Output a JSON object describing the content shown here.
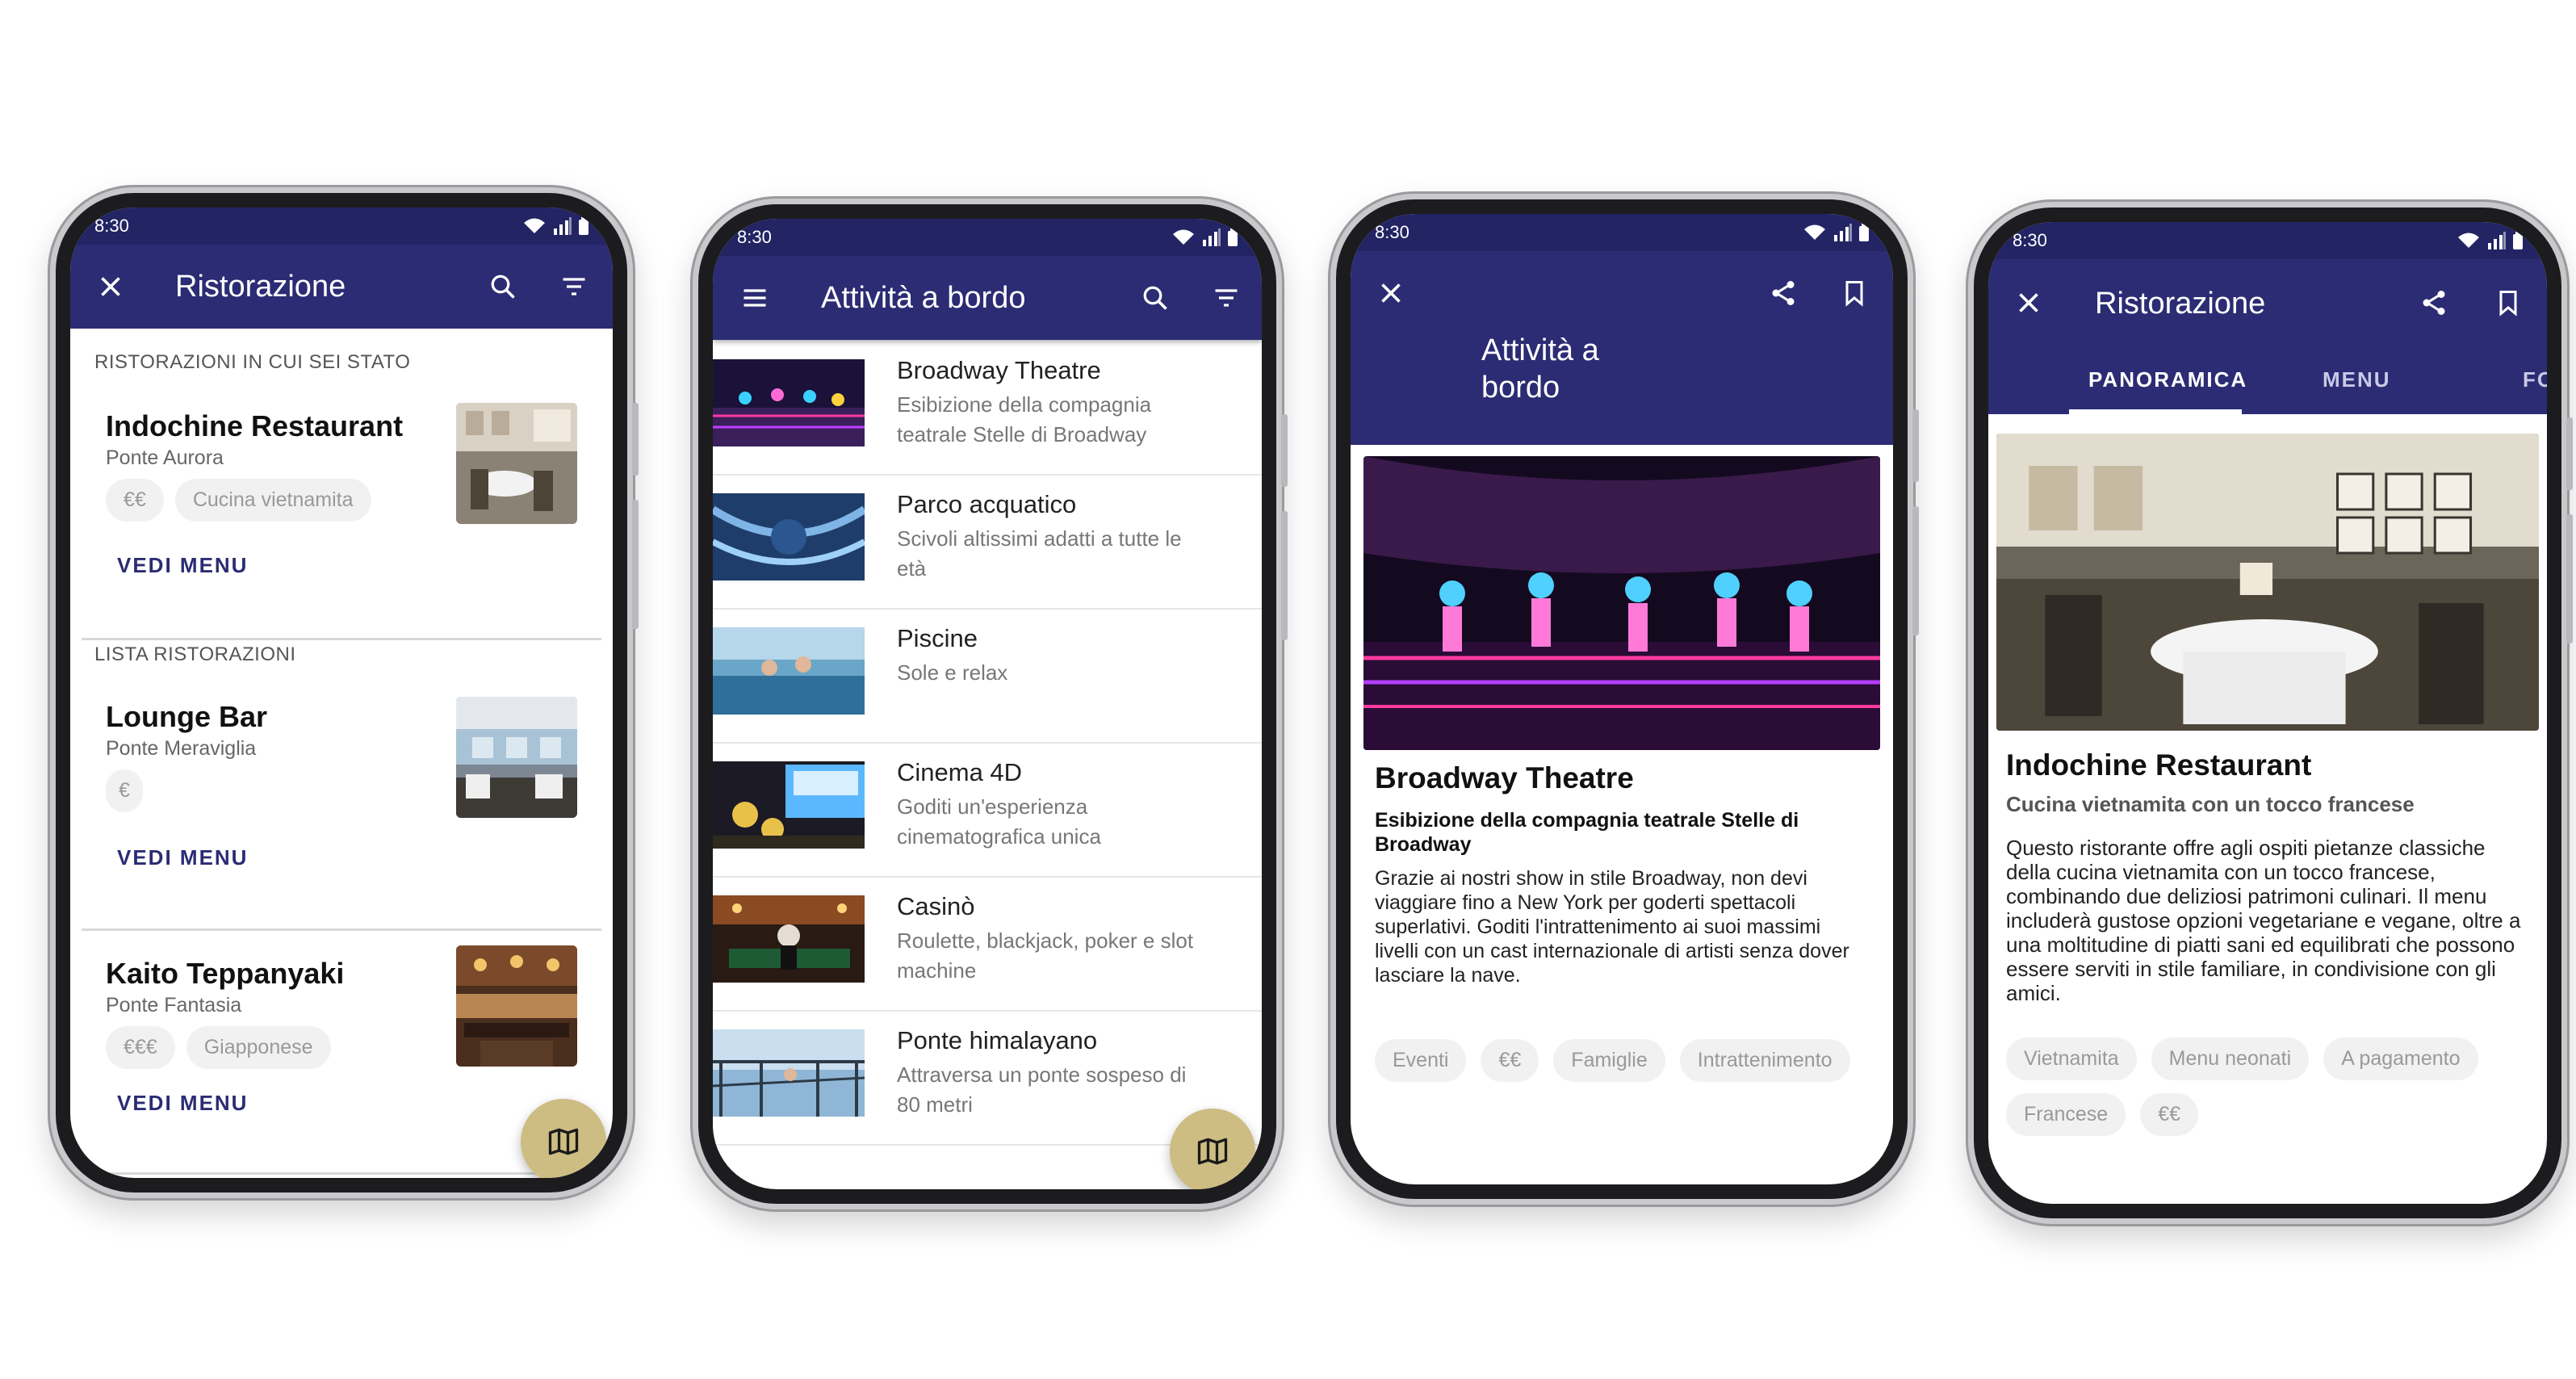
{
  "status_time": "8:30",
  "phone1": {
    "title": "Ristorazione",
    "section_visited": "RISTORAZIONI IN CUI SEI STATO",
    "section_list": "LISTA RISTORAZIONI",
    "restaurants": [
      {
        "name": "Indochine Restaurant",
        "deck": "Ponte Aurora",
        "tags": [
          "€€",
          "Cucina vietnamita"
        ],
        "action": "VEDI MENU"
      },
      {
        "name": "Lounge Bar",
        "deck": "Ponte Meraviglia",
        "tags": [
          "€"
        ],
        "action": "VEDI MENU"
      },
      {
        "name": "Kaito Teppanyaki",
        "deck": "Ponte Fantasia",
        "tags": [
          "€€€",
          "Giapponese"
        ],
        "action": "VEDI MENU"
      }
    ]
  },
  "phone2": {
    "title": "Attività a bordo",
    "activities": [
      {
        "title": "Broadway Theatre",
        "subtitle": "Esibizione della compagnia teatrale Stelle di Broadway"
      },
      {
        "title": "Parco acquatico",
        "subtitle": "Scivoli altissimi adatti a tutte le età"
      },
      {
        "title": "Piscine",
        "subtitle": "Sole e relax"
      },
      {
        "title": "Cinema 4D",
        "subtitle": "Goditi un'esperienza cinematografica unica"
      },
      {
        "title": "Casinò",
        "subtitle": "Roulette, blackjack, poker e slot machine"
      },
      {
        "title": "Ponte himalayano",
        "subtitle": "Attraversa un ponte sospeso di 80 metri"
      }
    ]
  },
  "phone3": {
    "title": "Attività a bordo",
    "heading": "Broadway Theatre",
    "subheading": "Esibizione della compagnia teatrale Stelle di Broadway",
    "body": "Grazie ai nostri show in stile Broadway, non devi viaggiare fino a New York per goderti spettacoli superlativi. Goditi l'intrattenimento ai suoi massimi livelli con un cast internazionale di artisti senza dover lasciare la nave.",
    "tags": [
      "Eventi",
      "€€",
      "Famiglie",
      "Intrattenimento"
    ]
  },
  "phone4": {
    "title": "Ristorazione",
    "tabs": [
      "PANORAMICA",
      "MENU",
      "FO"
    ],
    "heading": "Indochine Restaurant",
    "subheading": "Cucina vietnamita con un tocco francese",
    "body": "Questo ristorante offre agli ospiti pietanze classiche della cucina vietnamita con un tocco francese, combinando due deliziosi patrimoni culinari. Il menu includerà gustose opzioni vegetariane e vegane, oltre a una moltitudine di piatti sani ed equilibrati che possono essere serviti in stile familiare, in condivisione con gli amici.",
    "tags": [
      "Vietnamita",
      "Menu neonati",
      "A pagamento",
      "Francese",
      "€€"
    ]
  },
  "colors": {
    "appbar": "#2b2c73",
    "statusbar": "#232464",
    "accent": "#2b2c73",
    "fab": "#cdbd82"
  }
}
